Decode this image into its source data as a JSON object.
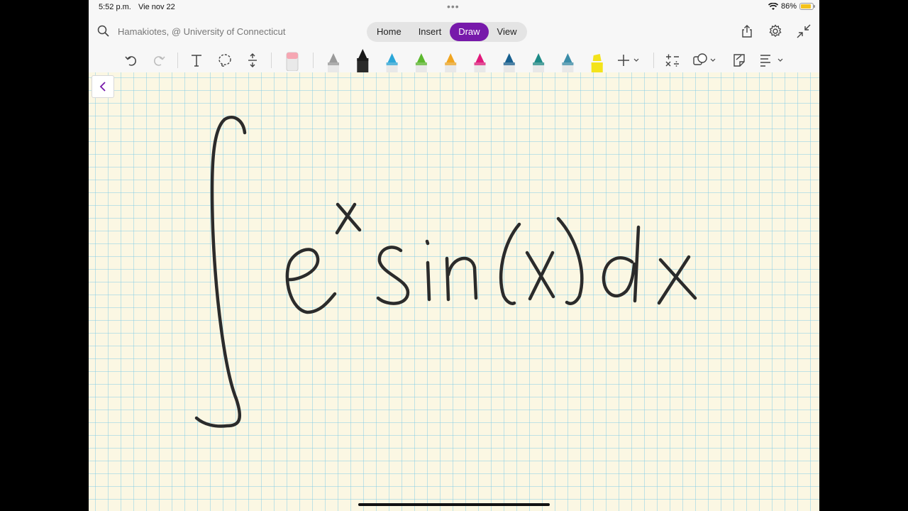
{
  "status_bar": {
    "time": "5:52 p.m.",
    "date": "Vie nov 22",
    "battery": "86%",
    "battery_level": 0.86,
    "wifi_icon": "wifi-icon"
  },
  "top_bar": {
    "notebook_label": "Hamakiotes, @ University of Connecticut",
    "tabs": [
      {
        "label": "Home"
      },
      {
        "label": "Insert"
      },
      {
        "label": "Draw",
        "active": true
      },
      {
        "label": "View"
      }
    ],
    "right_icons": [
      "share-icon",
      "settings-icon",
      "collapse-icon"
    ]
  },
  "toolbar": {
    "items": [
      "undo-icon",
      "redo-icon",
      "text-icon",
      "lasso-icon",
      "insert-space-icon",
      "eraser",
      "pens",
      "add-pen-icon",
      "ink-to-math-icon",
      "shapes-icon",
      "sticky-note-icon",
      "ink-to-text-icon"
    ],
    "pen_colors": [
      "#9a9a9a",
      "#1a1a1a",
      "#2aa6d8",
      "#5cb82e",
      "#f0a521",
      "#e0197b",
      "#175f8f",
      "#1d8a86",
      "#3a8ca8",
      "#f3e31b"
    ],
    "accent": "#7719aa"
  },
  "canvas": {
    "background": "#fbf7e3",
    "grid_color": "#a8dcee",
    "ink_color": "#2b2b2b",
    "handwriting_semantic": "integral e^x sin(x) dx"
  }
}
